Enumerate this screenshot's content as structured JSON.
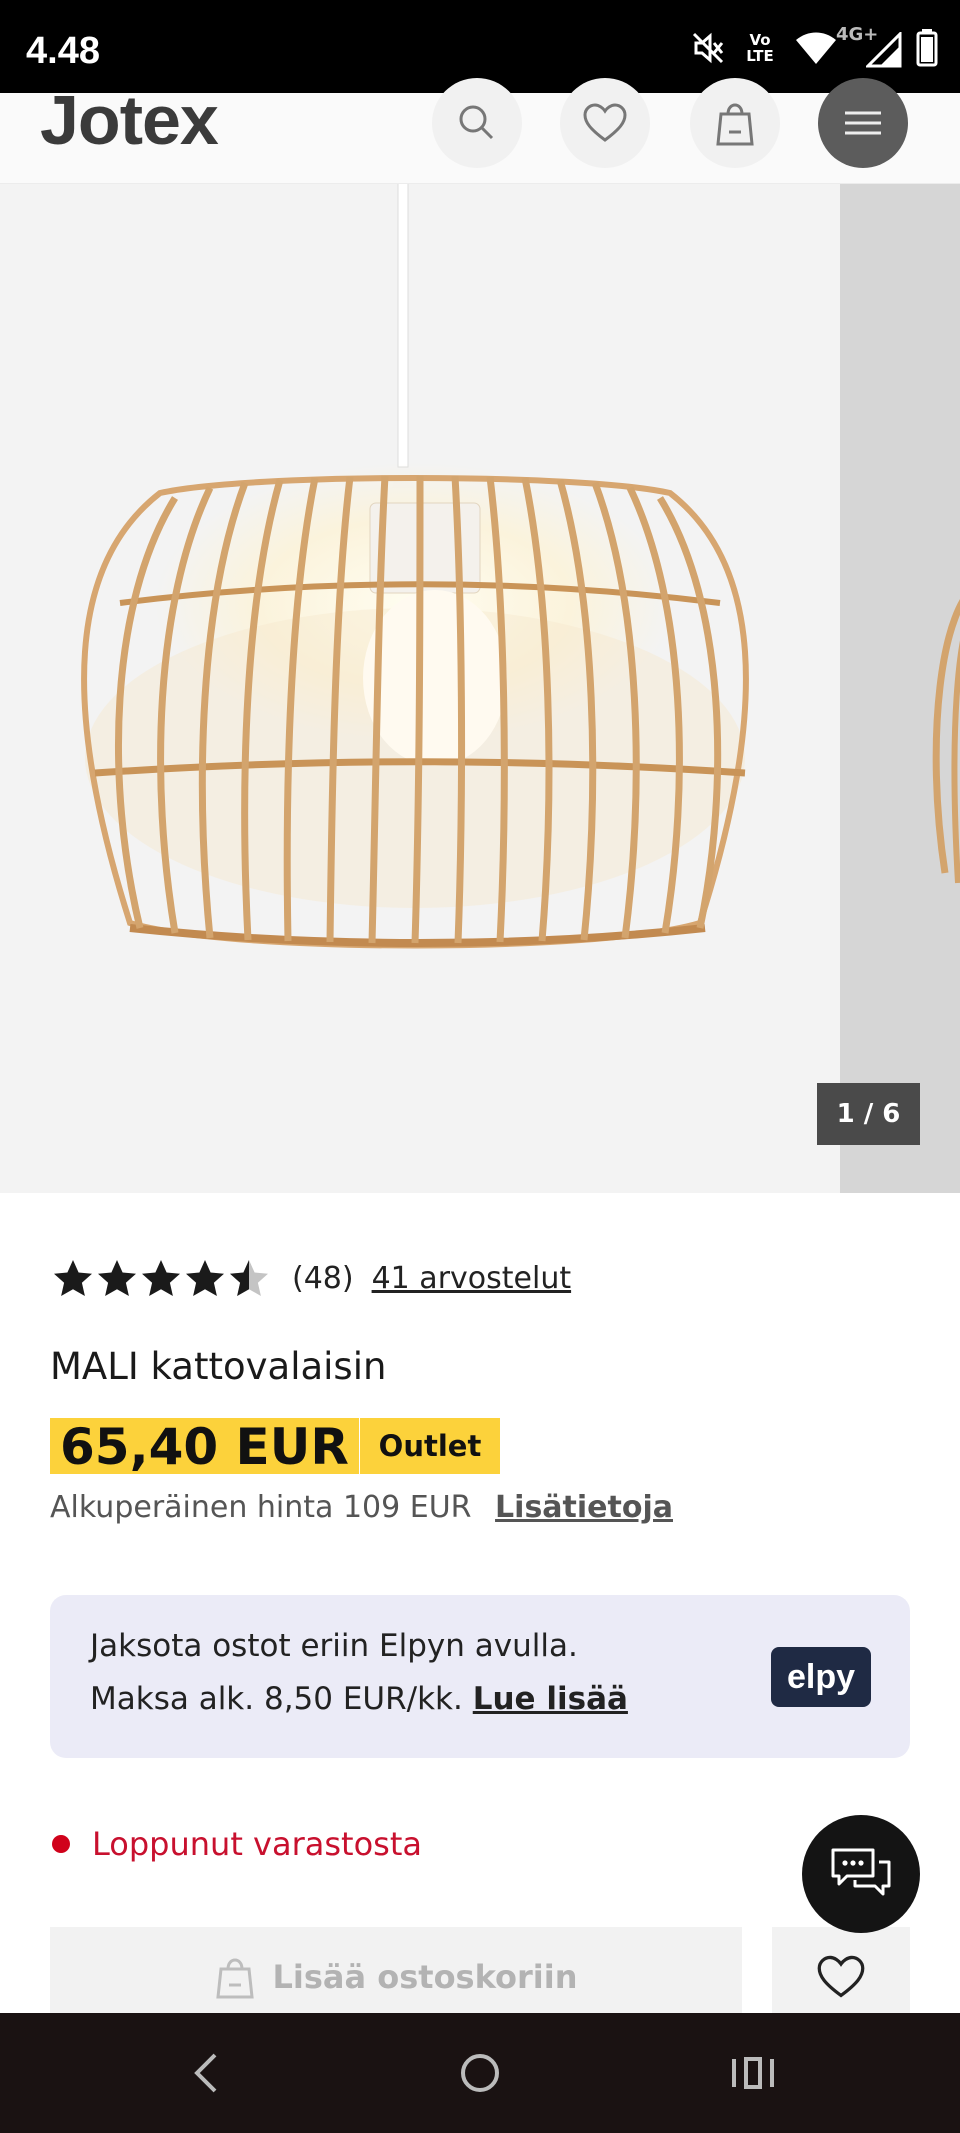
{
  "status_bar": {
    "time": "4.48",
    "network_label": "4G+",
    "volte_label": "Vo LTE",
    "icons": [
      "mute-icon",
      "volte-icon",
      "wifi-icon",
      "signal-icon",
      "battery-icon"
    ]
  },
  "header": {
    "logo": "Jotex",
    "icons": [
      "search-icon",
      "heart-icon",
      "shopping-bag-icon",
      "menu-icon"
    ]
  },
  "gallery": {
    "counter": "1 / 6"
  },
  "product": {
    "rating_value": 4.5,
    "rating_count": "(48)",
    "reviews_link": "41 arvostelut",
    "title": "MALI kattovalaisin",
    "price": "65,40 EUR",
    "badge": "Outlet",
    "original_price": "Alkuperäinen hinta 109 EUR",
    "more_info_link": "Lisätietoja"
  },
  "elpy": {
    "line1": "Jaksota ostot eriin Elpyn avulla.",
    "line2": "Maksa alk. 8,50 EUR/kk.",
    "link": "Lue lisää",
    "logo": "elpy"
  },
  "stock": {
    "status": "Loppunut varastosta",
    "color": "#c8102e"
  },
  "actions": {
    "add_to_cart": "Lisää ostoskoriin"
  },
  "colors": {
    "accent_yellow": "#fcd23b",
    "elpy_navy": "#1f2a44",
    "elpy_bg": "#ebebf7"
  },
  "nav_bar": {
    "icons": [
      "back-icon",
      "home-icon",
      "recents-icon"
    ]
  }
}
